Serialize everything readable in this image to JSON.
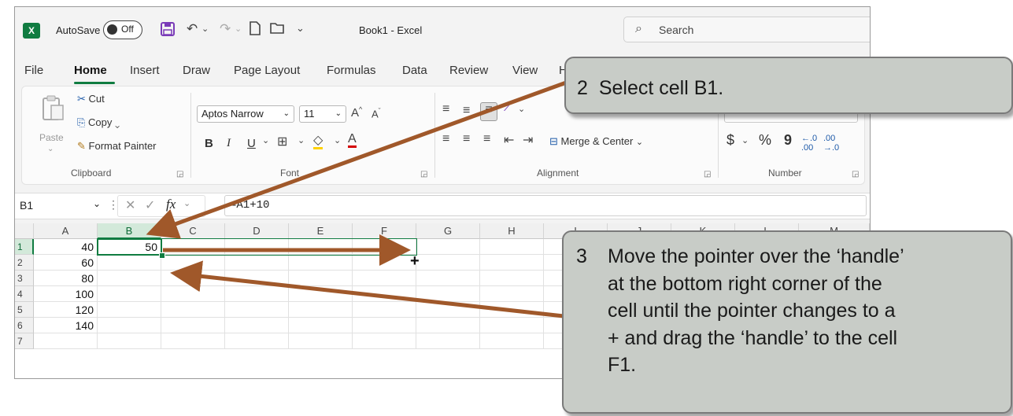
{
  "titlebar": {
    "app_letter": "X",
    "autosave_label": "AutoSave",
    "autosave_state": "Off",
    "quick_access_more": "⌄",
    "book_title": "Book1 - Excel",
    "search_placeholder": "Search"
  },
  "tabs": [
    "File",
    "Home",
    "Insert",
    "Draw",
    "Page Layout",
    "Formulas",
    "Data",
    "Review",
    "View",
    "H"
  ],
  "active_tab": "Home",
  "ribbon": {
    "clipboard": {
      "paste": "Paste",
      "cut": "Cut",
      "copy": "Copy",
      "copy_caret": "⌄",
      "format_painter": "Format Painter",
      "group_label": "Clipboard"
    },
    "font": {
      "font_name": "Aptos Narrow",
      "font_size": "11",
      "bold": "B",
      "italic": "I",
      "underline": "U",
      "group_label": "Font"
    },
    "alignment": {
      "merge_center": "Merge & Center",
      "group_label": "Alignment"
    },
    "number": {
      "currency": "$",
      "percent": "%",
      "comma": "9",
      "group_label": "Number"
    }
  },
  "formula_bar": {
    "name_box": "B1",
    "fx": "fx",
    "formula": "=A1+10"
  },
  "sheet": {
    "columns": [
      "A",
      "B",
      "C",
      "D",
      "E",
      "F",
      "G",
      "H",
      "I",
      "J",
      "K",
      "L",
      "M"
    ],
    "rows": [
      "1",
      "2",
      "3",
      "4",
      "5",
      "6",
      "7"
    ],
    "column_a": [
      "40",
      "60",
      "80",
      "100",
      "120",
      "140",
      ""
    ],
    "b1": "50",
    "fill_handle_cursor": "+"
  },
  "callouts": {
    "step2_number": "2",
    "step2_text": "Select cell B1.",
    "step3_number": "3",
    "step3_lines": [
      "Move the pointer over the ‘handle’",
      "at the bottom right corner of the",
      "cell until the pointer changes to a",
      "+ and drag the ‘handle’ to the cell",
      "F1."
    ]
  },
  "colors": {
    "excel_green": "#107c41",
    "arrow_brown": "#a0582a",
    "callout_fill": "#c8ccc7"
  }
}
